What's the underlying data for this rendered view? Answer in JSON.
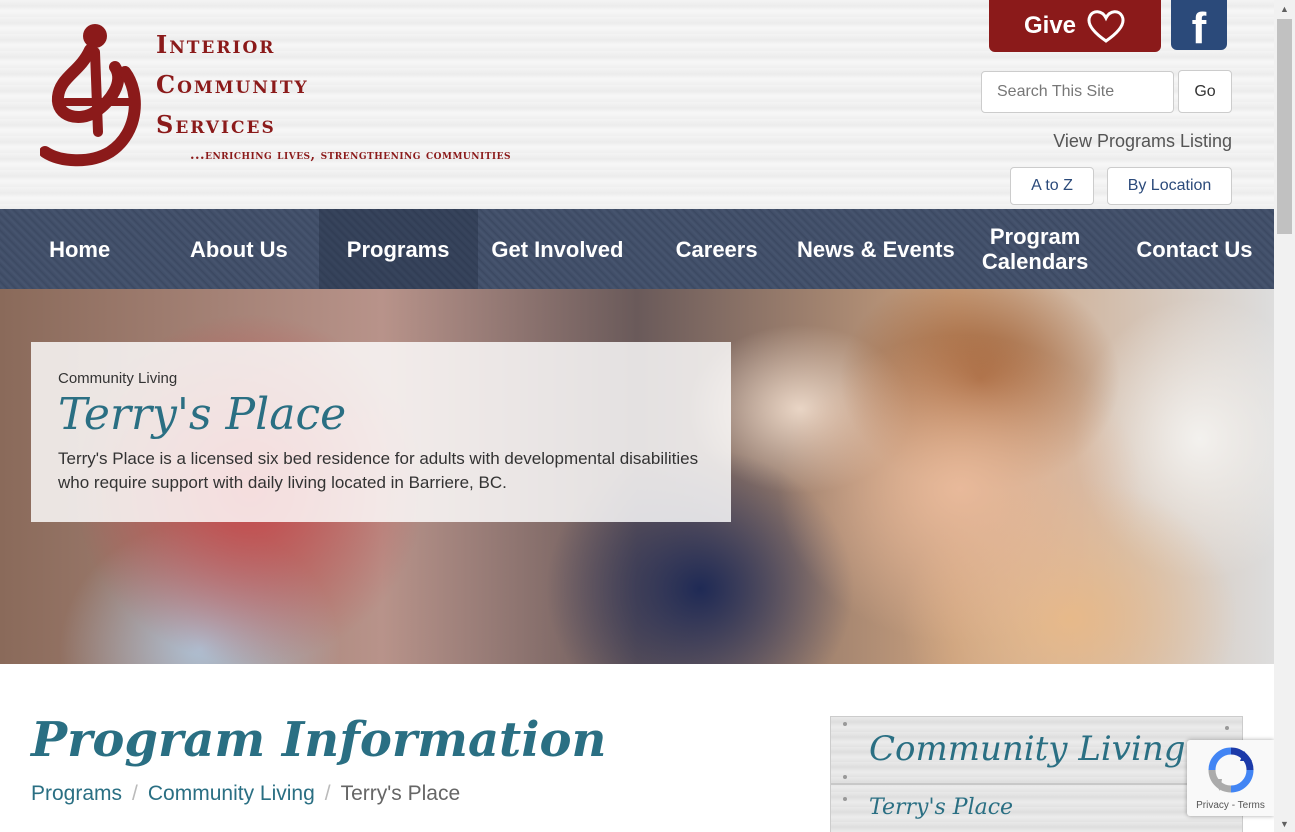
{
  "header": {
    "logo": {
      "line1": "Interior",
      "line2": "Community",
      "line3": "Services",
      "tagline": "...enriching lives, strengthening communities"
    },
    "give_label": "Give",
    "search_placeholder": "Search This Site",
    "go_label": "Go",
    "view_programs_label": "View Programs Listing",
    "az_label": "A to Z",
    "location_label": "By Location"
  },
  "nav": {
    "items": [
      {
        "label": "Home"
      },
      {
        "label": "About Us"
      },
      {
        "label": "Programs"
      },
      {
        "label": "Get Involved"
      },
      {
        "label": "Careers"
      },
      {
        "label": "News & Events"
      },
      {
        "label": "Program Calendars"
      },
      {
        "label": "Contact Us"
      }
    ],
    "active_index": 2
  },
  "hero": {
    "category": "Community Living",
    "title": "Terry's Place",
    "description": "Terry's Place is a licensed six bed residence for adults with developmental disabilities who require support with daily living located in Barriere, BC."
  },
  "content": {
    "title": "Program Information",
    "breadcrumb": [
      "Programs",
      "Community Living",
      "Terry's Place"
    ]
  },
  "sidebar": {
    "title": "Community Living",
    "items": [
      "Terry's Place"
    ]
  },
  "recaptcha": {
    "links": "Privacy - Terms"
  },
  "colors": {
    "brand_red": "#8b1a1a",
    "teal": "#2a6f83",
    "nav_bg": "#3f4c66",
    "facebook_blue": "#2b4a7a"
  }
}
